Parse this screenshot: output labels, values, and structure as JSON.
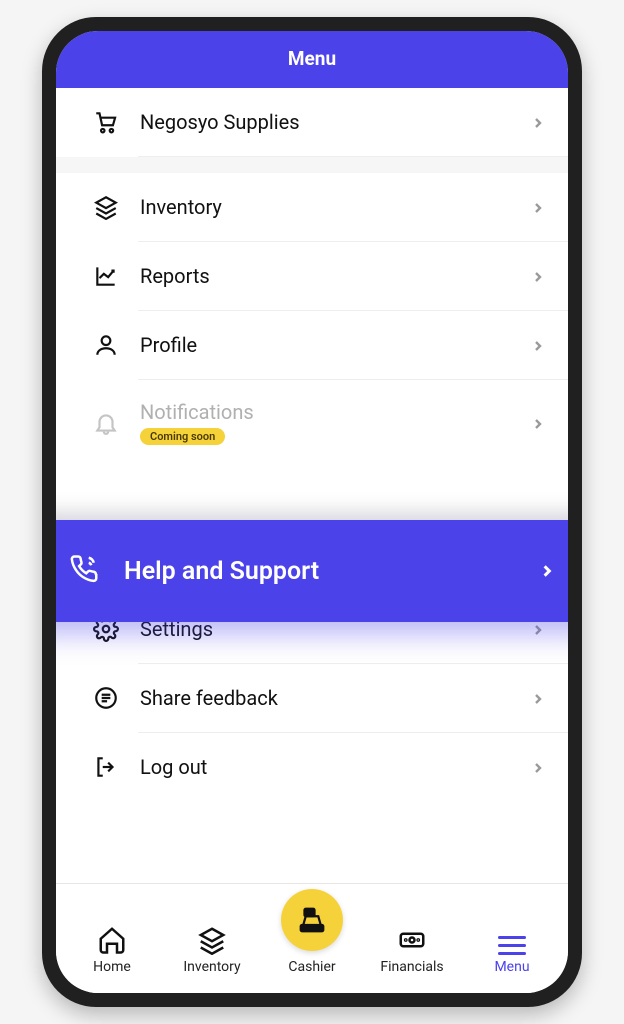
{
  "header": {
    "title": "Menu"
  },
  "menu": {
    "negosyo": {
      "label": "Negosyo Supplies"
    },
    "inventory": {
      "label": "Inventory"
    },
    "reports": {
      "label": "Reports"
    },
    "profile": {
      "label": "Profile"
    },
    "notifications": {
      "label": "Notifications",
      "badge": "Coming soon"
    },
    "help": {
      "label": "Help and Support"
    },
    "settings": {
      "label": "Settings"
    },
    "feedback": {
      "label": "Share feedback"
    },
    "logout": {
      "label": "Log out"
    }
  },
  "nav": {
    "home": {
      "label": "Home"
    },
    "inventory": {
      "label": "Inventory"
    },
    "cashier": {
      "label": "Cashier"
    },
    "financials": {
      "label": "Financials"
    },
    "menu": {
      "label": "Menu"
    }
  }
}
